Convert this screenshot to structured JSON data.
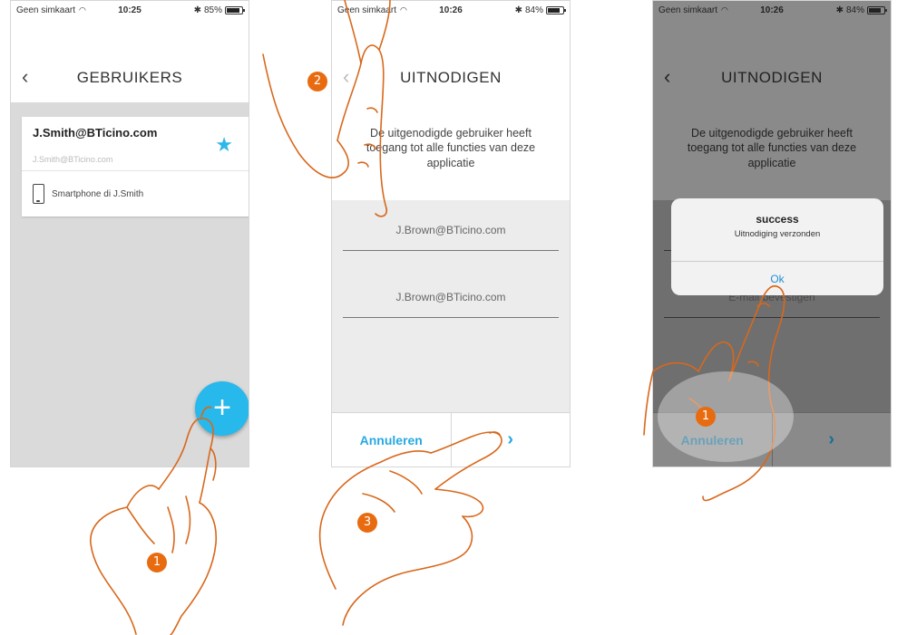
{
  "screen1": {
    "status": {
      "carrier": "Geen simkaart",
      "time": "10:25",
      "battery": "85%",
      "battery_level": 0.85
    },
    "nav": {
      "back": "‹",
      "title": "GEBRUIKERS"
    },
    "user": {
      "email": "J.Smith@BTicino.com",
      "sub_email": "J.Smith@BTicino.com",
      "device": "Smartphone di J.Smith"
    },
    "fab_label": "+"
  },
  "screen2": {
    "status": {
      "carrier": "Geen simkaart",
      "time": "10:26",
      "battery": "84%",
      "battery_level": 0.84
    },
    "nav": {
      "back": "‹",
      "title": "UITNODIGEN"
    },
    "description": "De uitgenodigde gebruiker heeft toegang tot alle functies van deze applicatie",
    "email_field": "J.Brown@BTicino.com",
    "confirm_field": "J.Brown@BTicino.com",
    "footer": {
      "cancel": "Annuleren",
      "next": "›"
    }
  },
  "screen3": {
    "status": {
      "carrier": "Geen simkaart",
      "time": "10:26",
      "battery": "84%",
      "battery_level": 0.84
    },
    "nav": {
      "back": "‹",
      "title": "UITNODIGEN"
    },
    "description": "De uitgenodigde gebruiker heeft toegang tot alle functies van deze applicatie",
    "confirm_field": "E-mail bevestigen",
    "dialog": {
      "title": "success",
      "message": "Uitnodiging verzonden",
      "ok": "Ok"
    },
    "footer": {
      "cancel": "Annuleren",
      "next": "›"
    }
  },
  "steps": {
    "step_a": "1",
    "step_b": "2",
    "step_c": "3",
    "step_d": "1"
  },
  "colors": {
    "accent": "#27b8ec",
    "callout": "#e86b10"
  }
}
